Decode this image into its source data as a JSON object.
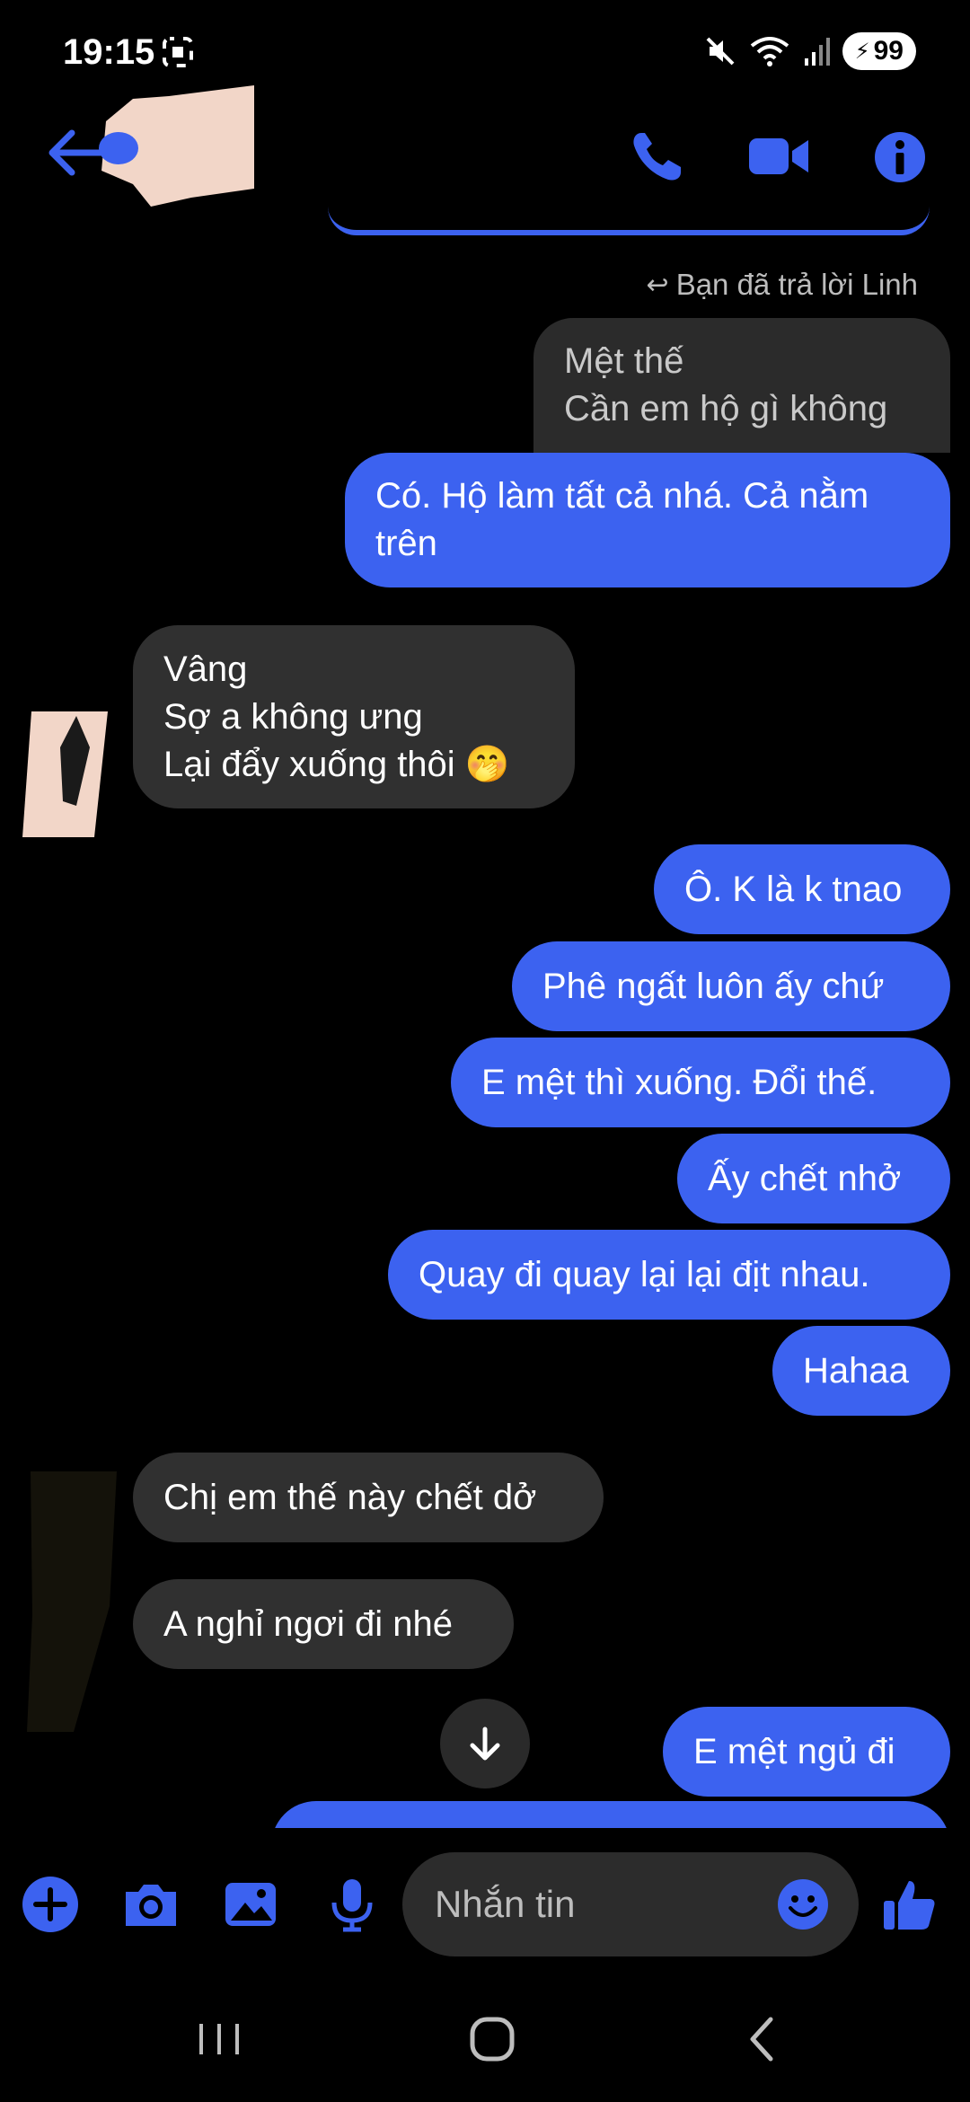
{
  "status": {
    "time": "19:15",
    "battery": "99"
  },
  "header": {
    "back_label": "Back",
    "call": "phone-icon",
    "video": "video-icon",
    "info": "info-icon"
  },
  "chat": {
    "reply_note": "Bạn đã trả lời Linh",
    "quoted": [
      "Mệt thế",
      "Cần em hộ gì không"
    ],
    "messages": [
      {
        "from": "me",
        "lines": [
          "Có. Hộ làm tất cả nhá. Cả nằm",
          "trên"
        ]
      },
      {
        "from": "them",
        "lines": [
          "Vâng",
          "Sợ a không ưng",
          "Lại đẩy xuống thôi 🤭"
        ]
      },
      {
        "from": "me",
        "lines": [
          "Ô. K là k tnao"
        ]
      },
      {
        "from": "me",
        "lines": [
          "Phê ngất luôn ấy chứ"
        ]
      },
      {
        "from": "me",
        "lines": [
          "E mệt thì xuống. Đổi thế."
        ]
      },
      {
        "from": "me",
        "lines": [
          "Ấy chết nhở"
        ]
      },
      {
        "from": "me",
        "lines": [
          "Quay đi quay lại lại địt nhau."
        ]
      },
      {
        "from": "me",
        "lines": [
          "Hahaa"
        ]
      },
      {
        "from": "them",
        "lines": [
          "Chị em thế này chết dở"
        ]
      },
      {
        "from": "them",
        "lines": [
          "A nghỉ ngơi đi nhé"
        ]
      },
      {
        "from": "me",
        "lines": [
          "E mệt ngủ đi"
        ]
      }
    ]
  },
  "composer": {
    "placeholder": "Nhắn tin"
  },
  "colors": {
    "accent": "#3c62f0",
    "incoming": "#303030",
    "background": "#000000"
  }
}
